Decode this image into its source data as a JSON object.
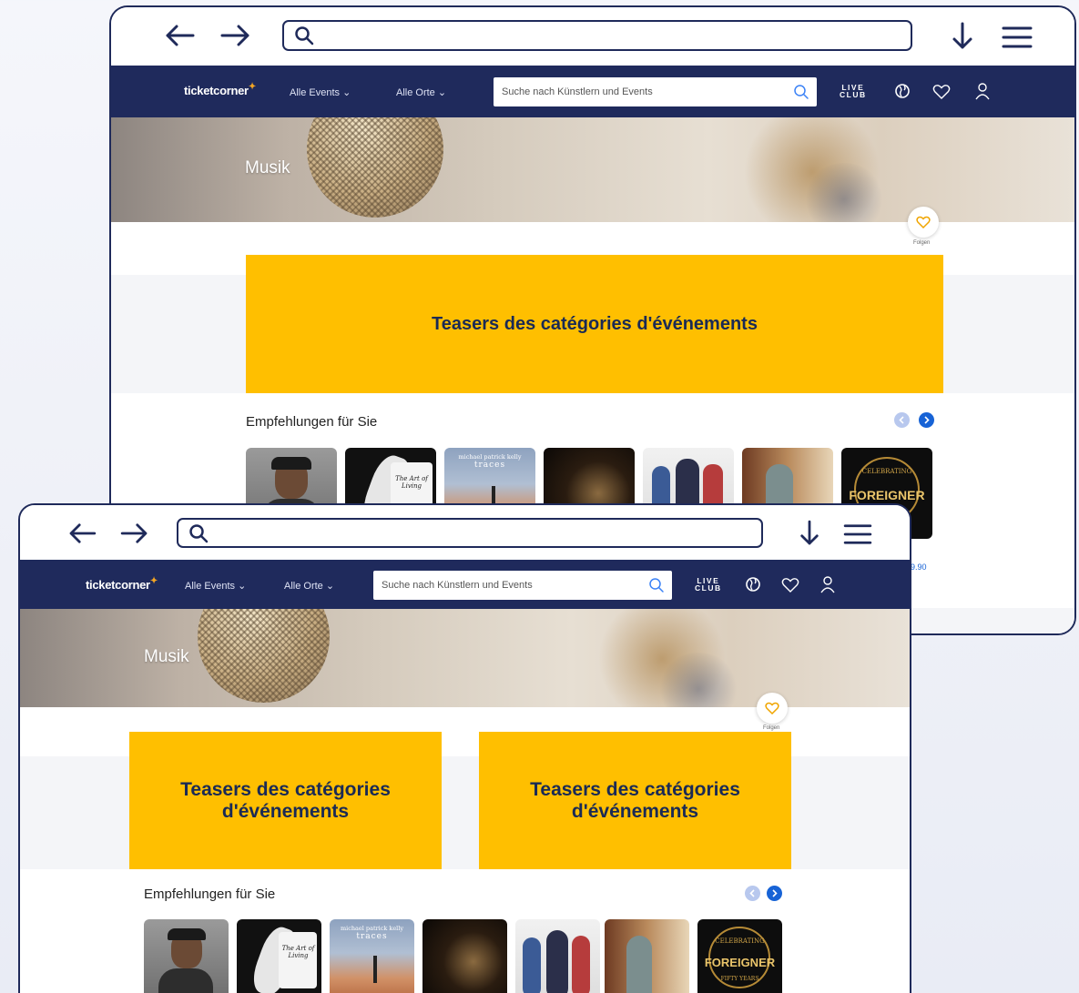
{
  "windows": [
    {
      "id": "back",
      "header": {
        "logo": "ticketcorner",
        "menu_events": "Alle Events ⌄",
        "menu_places": "Alle Orte ⌄",
        "search_placeholder": "Suche nach Künstlern und Events",
        "live_club_line1": "LIVE",
        "live_club_line2": "CLUB"
      },
      "hero_title": "Musik",
      "follow_label": "Folgen",
      "teasers": [
        "Teasers des catégories d'événements"
      ],
      "recommendations_title": "Empfehlungen für Sie",
      "thumb_texts": {
        "art_of_living": "The Art of Living",
        "mpk": "michael patrick kelly",
        "traces": "traces",
        "foreigner": "FOREIGNER",
        "celebrating": "CELEBRATING"
      },
      "partial_price": "9.90"
    },
    {
      "id": "front",
      "header": {
        "logo": "ticketcorner",
        "menu_events": "Alle Events ⌄",
        "menu_places": "Alle Orte ⌄",
        "search_placeholder": "Suche nach Künstlern und Events",
        "live_club_line1": "LIVE",
        "live_club_line2": "CLUB"
      },
      "hero_title": "Musik",
      "follow_label": "Folgen",
      "teasers": [
        "Teasers des catégories d'événements",
        "Teasers des catégories d'événements"
      ],
      "recommendations_title": "Empfehlungen für Sie",
      "thumb_texts": {
        "art_of_living": "The Art of Living",
        "mpk": "michael patrick kelly",
        "traces": "traces",
        "foreigner": "FOREIGNER",
        "celebrating": "CELEBRATING",
        "fifty_years": "FIFTY YEARS"
      }
    }
  ],
  "icons": {
    "back": "arrow-left-icon",
    "forward": "arrow-right-icon",
    "search": "search-icon",
    "download": "arrow-down-icon",
    "menu": "hamburger-icon",
    "globe": "globe-icon",
    "favorites": "heart-icon",
    "account": "user-icon",
    "follow": "heart-icon",
    "prev": "chevron-left-icon",
    "next": "chevron-right-icon"
  },
  "colors": {
    "navy": "#1f2a5c",
    "teaser": "#ffbf00",
    "accent_blue": "#1763d6",
    "logo_star": "#f5a623"
  }
}
